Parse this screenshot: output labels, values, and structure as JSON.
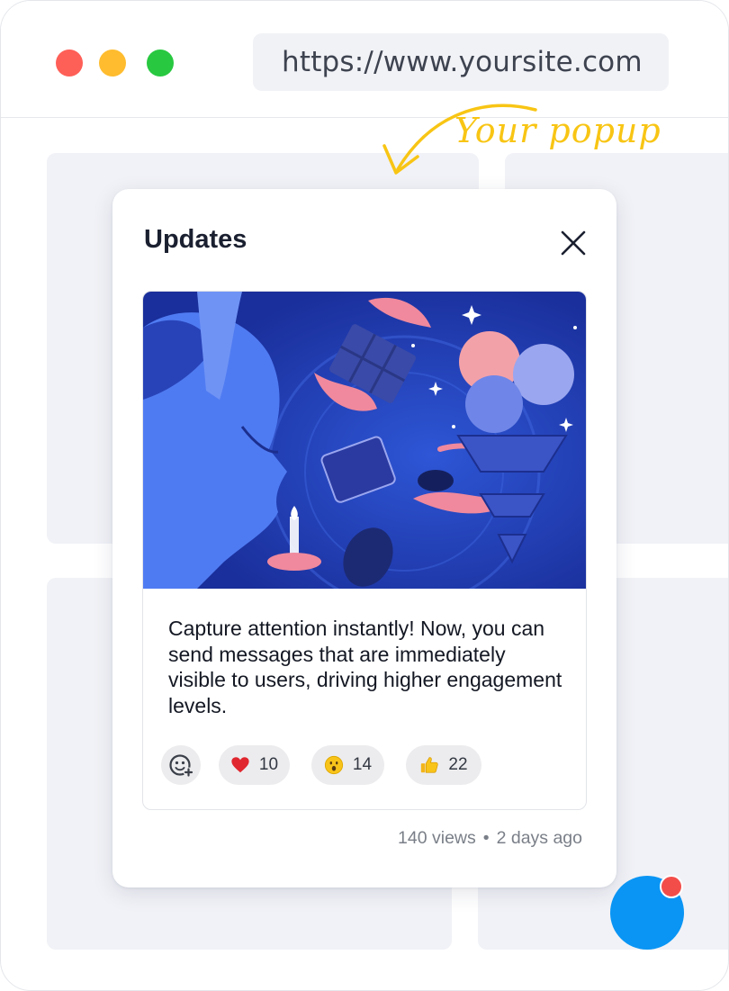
{
  "browser": {
    "url": "https://www.yoursite.com",
    "controls": [
      "close",
      "minimize",
      "maximize"
    ]
  },
  "annotation": {
    "text": "Your popup",
    "color": "#f8c514"
  },
  "popup": {
    "title": "Updates",
    "close_icon": "close-icon",
    "message": "Capture attention instantly! Now, you can send messages that are immediately visible to users, driving higher engagement levels.",
    "reactions": [
      {
        "emoji": "heart",
        "count": "10"
      },
      {
        "emoji": "surprised-face",
        "count": "14"
      },
      {
        "emoji": "thumbs-up",
        "count": "22"
      }
    ],
    "add_reaction_icon": "add-emoji-icon",
    "views": "140 views",
    "separator": "•",
    "time": "2 days ago"
  },
  "launcher": {
    "color": "#0a95f4",
    "badge_color": "#f34d4a"
  }
}
